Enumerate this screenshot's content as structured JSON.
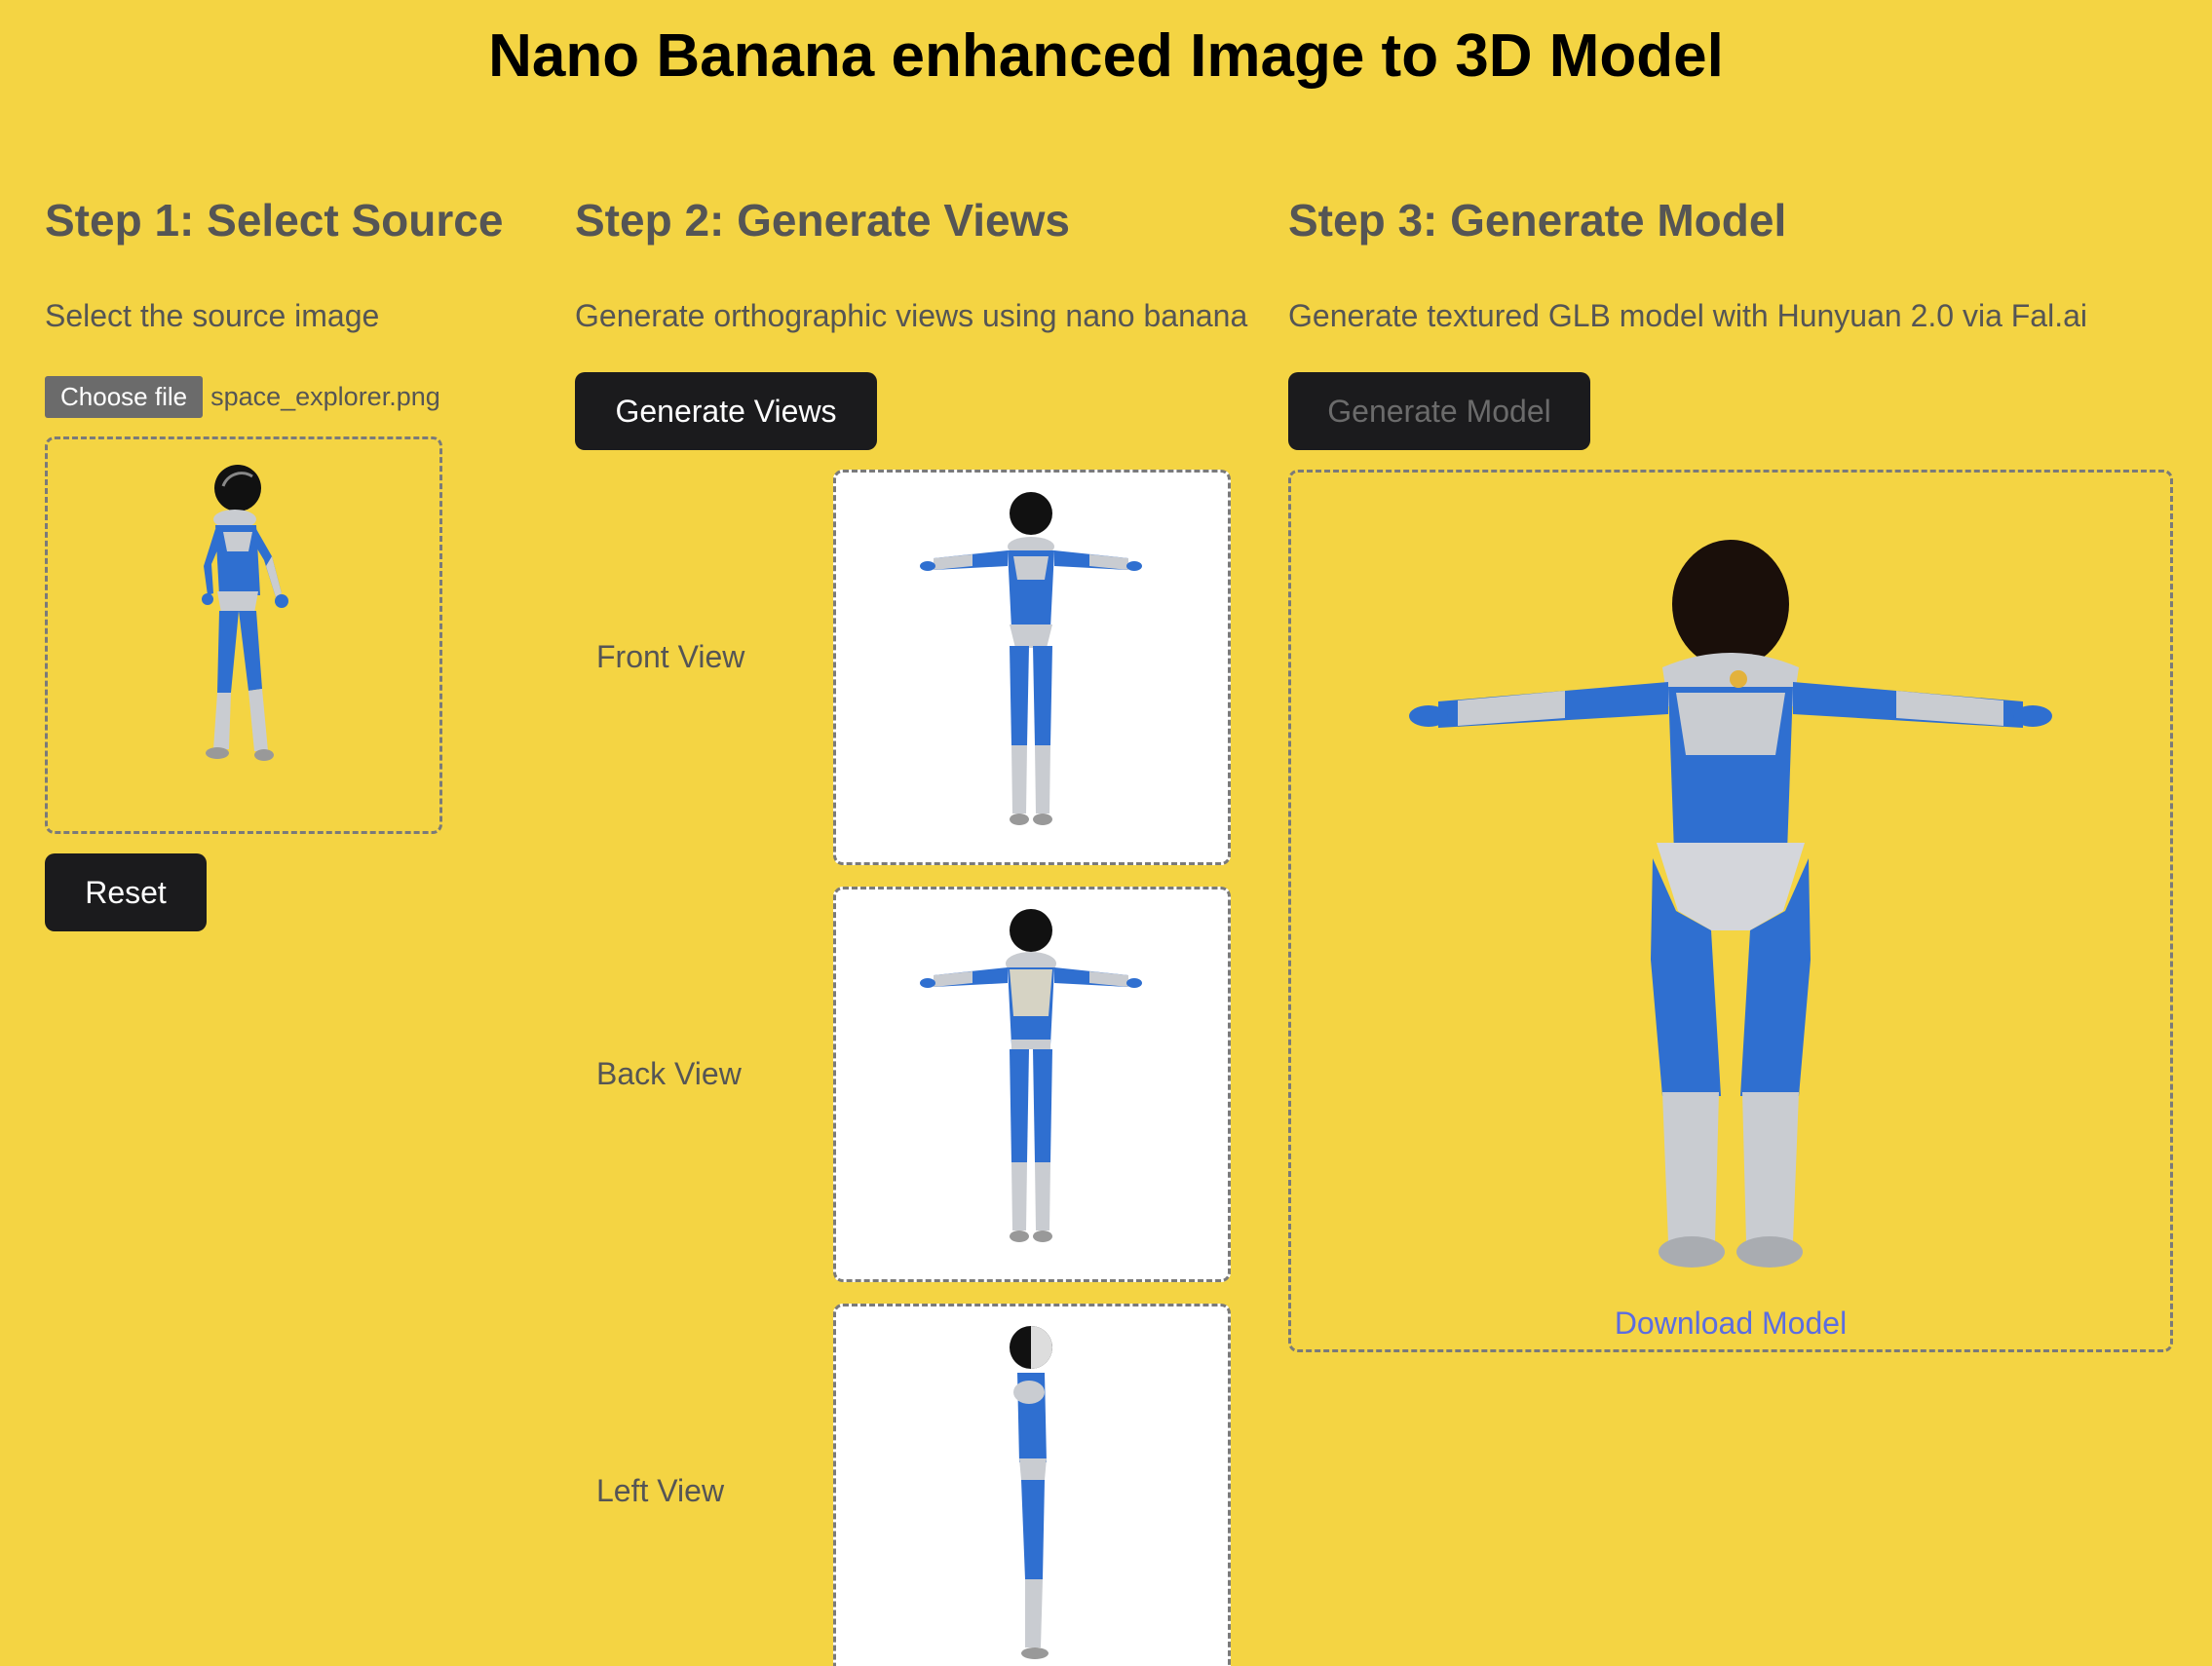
{
  "header": {
    "title": "Nano Banana enhanced Image to 3D Model"
  },
  "step1": {
    "heading": "Step 1: Select Source",
    "description": "Select the source image",
    "choose_file_label": "Choose file",
    "file_name": "space_explorer.png",
    "reset_label": "Reset"
  },
  "step2": {
    "heading": "Step 2: Generate Views",
    "description": "Generate orthographic views using nano banana",
    "button_label": "Generate Views",
    "views": [
      {
        "label": "Front View"
      },
      {
        "label": "Back View"
      },
      {
        "label": "Left View"
      }
    ]
  },
  "step3": {
    "heading": "Step 3: Generate Model",
    "description": "Generate textured GLB model with Hunyuan 2.0 via Fal.ai",
    "button_label": "Generate Model",
    "button_disabled": true,
    "download_label": "Download Model"
  },
  "colors": {
    "background": "#F4D443",
    "button": "#1b1b1d",
    "link": "#5b6de2",
    "suit_blue": "#2f6fd0",
    "suit_silver": "#c9ccd1"
  }
}
